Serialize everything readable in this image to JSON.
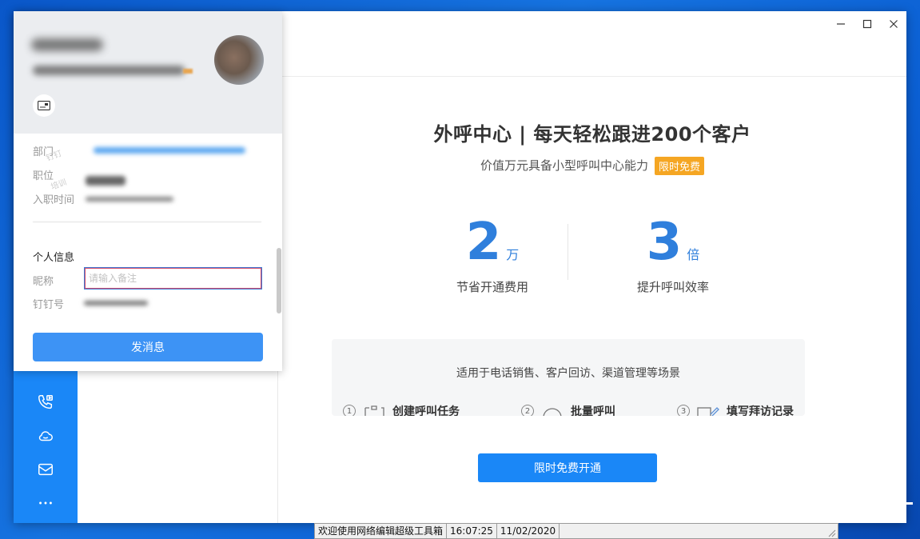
{
  "window": {
    "controls": {
      "minimize": "—",
      "maximize": "☐",
      "close": "✕"
    }
  },
  "nav": {
    "icons": [
      "phone-call-icon",
      "cloud-icon",
      "mail-icon",
      "more-icon"
    ]
  },
  "main": {
    "headline": "外呼中心 | 每天轻松跟进200个客户",
    "subline": "价值万元具备小型呼叫中心能力",
    "badge": "限时免费",
    "stats": [
      {
        "value": "2",
        "unit": "万",
        "label": "节省开通费用"
      },
      {
        "value": "3",
        "unit": "倍",
        "label": "提升呼叫效率"
      }
    ],
    "scenario_title": "适用于电话销售、客户回访、渠道管理等场景",
    "steps": [
      {
        "num": "1",
        "label": "创建呼叫任务"
      },
      {
        "num": "2",
        "label": "批量呼叫"
      },
      {
        "num": "3",
        "label": "填写拜访记录"
      }
    ],
    "cta": "限时免费开通"
  },
  "profile": {
    "fields": {
      "department": "部门",
      "position": "职位",
      "hire_date": "入职时间"
    },
    "personal_title": "个人信息",
    "nickname_label": "昵称",
    "nickname_placeholder": "请输入备注",
    "dingtalk_label": "钉钉号",
    "send_button": "发消息",
    "watermarks": [
      "钉钉",
      "培训"
    ]
  },
  "statusbar": {
    "message": "欢迎使用网络编辑超级工具箱",
    "time": "16:07:25",
    "date": "11/02/2020"
  },
  "colors": {
    "accent": "#1a87f7",
    "stat_blue": "#2f7fdc",
    "badge_orange": "#f5a623"
  }
}
